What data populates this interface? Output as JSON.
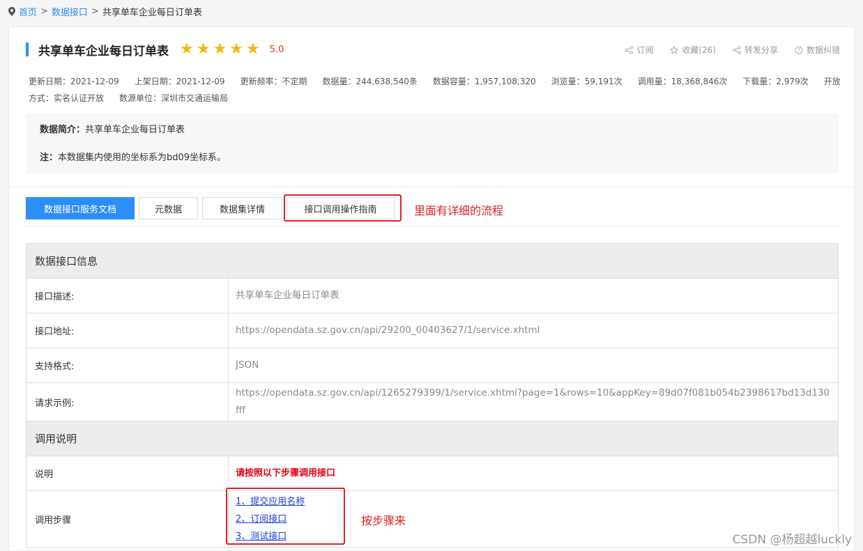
{
  "breadcrumb": {
    "home": "首页",
    "sep1": ">",
    "interfaces": "数据接口",
    "sep2": ">",
    "current": "共享单车企业每日订单表"
  },
  "header": {
    "title": "共享单车企业每日订单表",
    "score": "5.0",
    "stars": 5
  },
  "actions": [
    {
      "icon": "share-icon",
      "label": "订阅"
    },
    {
      "icon": "star-outline-icon",
      "label": "收藏(26)"
    },
    {
      "icon": "share-icon",
      "label": "转发分享"
    },
    {
      "icon": "help-circle-icon",
      "label": "数据纠错"
    }
  ],
  "meta": {
    "update_date": "更新日期：2021-12-09",
    "publish_date": "上架日期：2021-12-09",
    "frequency": "更新频率：不定期",
    "data_count": "数据量：244,638,540条",
    "capacity": "数据容量：1,957,108,320",
    "views": "浏览量：59,191次",
    "calls": "调用量：18,368,846次",
    "downloads": "下载量：2,979次",
    "open_mode": "开放方式：实名认证开放",
    "source": "数源单位：深圳市交通运输局"
  },
  "intro": {
    "summary_label": "数据简介：",
    "summary": "共享单车企业每日订单表",
    "note_label": "注：",
    "note": "本数据集内使用的坐标系为bd09坐标系。"
  },
  "tabs": [
    "数据接口服务文档",
    "元数据",
    "数据集详情",
    "接口调用操作指南"
  ],
  "annotations": {
    "tab_note": "里面有详细的流程",
    "steps_note": "按步骤来"
  },
  "info": {
    "section1": "数据接口信息",
    "rows": [
      {
        "label": "接口描述:",
        "value": "共享单车企业每日订单表"
      },
      {
        "label": "接口地址:",
        "value": "https://opendata.sz.gov.cn/api/29200_00403627/1/service.xhtml"
      },
      {
        "label": "支持格式:",
        "value": "JSON"
      },
      {
        "label": "请求示例:",
        "value": "https://opendata.sz.gov.cn/api/1265279399/1/service.xhtml?page=1&rows=10&appKey=89d07f081b054b2398617bd13d130fff"
      }
    ],
    "section2": "调用说明",
    "explain_label": "说明",
    "explain_value": "请按照以下步骤调用接口",
    "steps_label": "调用步骤",
    "steps": [
      "1、提交应用名称",
      "2、订阅接口",
      "3、测试接口"
    ]
  },
  "watermark": "CSDN @杨超越luckly",
  "colors": {
    "accent": "#2c8ef7",
    "star": "#f5b800",
    "annotation": "#e02020",
    "link": "#1a3cd6"
  }
}
